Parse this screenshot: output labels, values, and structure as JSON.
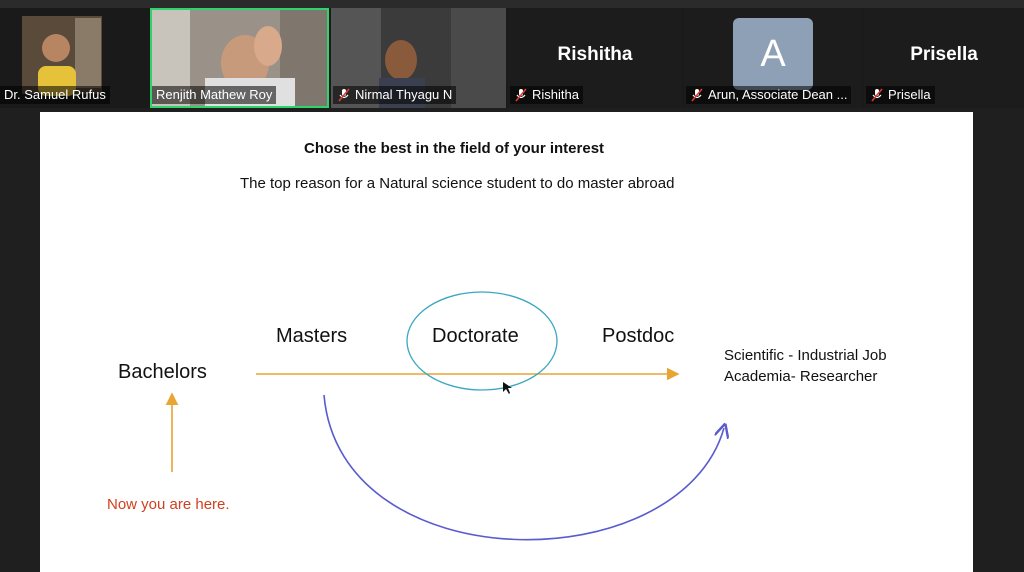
{
  "participants": [
    {
      "name": "Dr. Samuel Rufus",
      "muted": false,
      "video": true
    },
    {
      "name": "Renjith Mathew Roy",
      "muted": false,
      "video": true,
      "speaking": true
    },
    {
      "name": "Nirmal Thyagu N",
      "muted": true,
      "video": true
    },
    {
      "name": "Rishitha",
      "display_name": "Rishitha",
      "muted": true,
      "video": false
    },
    {
      "name": "Arun, Associate Dean ...",
      "avatar_letter": "A",
      "muted": true,
      "video": false
    },
    {
      "name": "Prisella",
      "display_name": "Prisella",
      "muted": true,
      "video": false
    }
  ],
  "slide": {
    "title": "Chose the best in the field of your interest",
    "subtitle": "The top reason for a Natural science  student to do master abroad",
    "bachelors": "Bachelors",
    "masters": "Masters",
    "doctorate": "Doctorate",
    "postdoc": "Postdoc",
    "outcome_1": "Scientific - Industrial Job",
    "outcome_2": "Academia- Researcher",
    "you_are_here": "Now you are here."
  },
  "colors": {
    "speaking_border": "#2fd36b",
    "arrow_orange": "#e8a534",
    "arrow_blue": "#5b5bd0",
    "circle_teal": "#3aa7c0",
    "here_red": "#d04020",
    "avatar_bg": "#8ea0b5"
  }
}
